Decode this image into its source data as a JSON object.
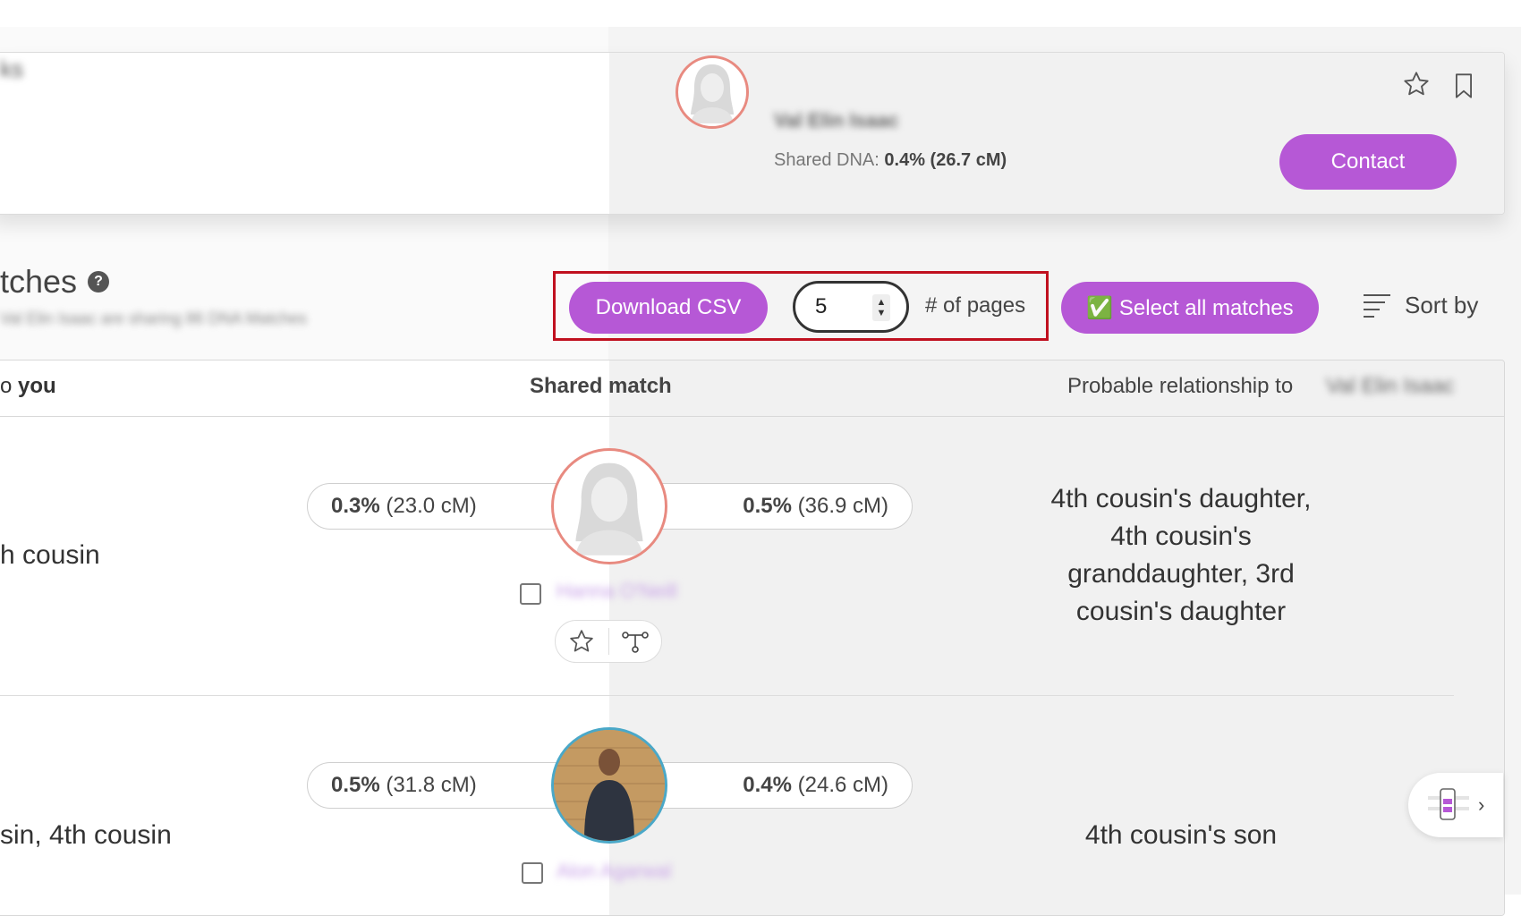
{
  "card": {
    "left_name": "ks",
    "name": "Val Elin Isaac",
    "dna_label": "Shared DNA:",
    "dna_value": "0.4% (26.7 cM)",
    "contact_label": "Contact",
    "star_icon": "star-icon",
    "bookmark_icon": "bookmark-icon"
  },
  "section": {
    "title": "tches",
    "subtitle": "Val Elin Isaac are sharing 86 DNA Matches",
    "help_glyph": "?"
  },
  "toolbar": {
    "download_label": "Download CSV",
    "pages_value": "5",
    "pages_label": "# of pages",
    "select_all_label": "✅ Select all matches",
    "sort_label": "Sort by"
  },
  "table": {
    "headers": {
      "to_you_prefix": "o ",
      "to_you_bold": "you",
      "shared": "Shared match",
      "probable": "Probable relationship to",
      "probable_name": "Val Elin Isaac"
    },
    "rows": [
      {
        "relationship_left": "h cousin",
        "left_pct": "0.3%",
        "left_cm": "(23.0 cM)",
        "right_pct": "0.5%",
        "right_cm": "(36.9 cM)",
        "name": "Hanna O'Neill",
        "relationship_right_lines": [
          "4th cousin's daughter,",
          "4th cousin's",
          "granddaughter, 3rd",
          "cousin's daughter"
        ]
      },
      {
        "relationship_left": "sin, 4th cousin",
        "left_pct": "0.5%",
        "left_cm": "(31.8 cM)",
        "right_pct": "0.4%",
        "right_cm": "(24.6 cM)",
        "name": "Alon Agarwal",
        "relationship_right": "4th cousin's son"
      }
    ]
  },
  "colors": {
    "accent": "#b658d6",
    "highlight_border": "#c0101f",
    "avatar_ring_female": "#e88a80",
    "avatar_ring_male": "#4aa8c8"
  }
}
